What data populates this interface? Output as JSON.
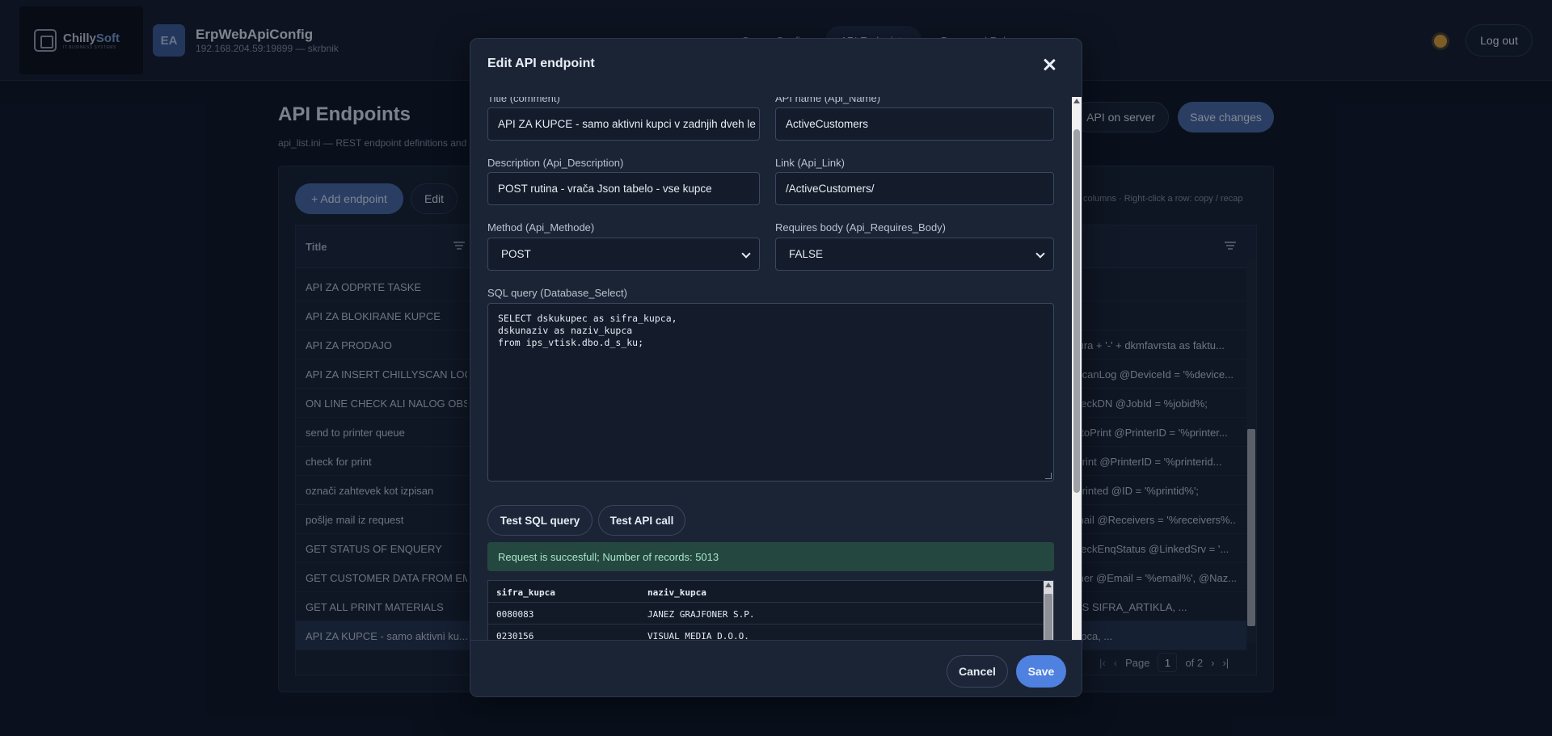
{
  "header": {
    "logo_brand_a": "Chilly",
    "logo_brand_b": "Soft",
    "logo_tag": "IT BUSINESS SYSTEMS",
    "avatar": "EA",
    "app_name": "ErpWebApiConfig",
    "app_sub": "192.168.204.59:19899 — skrbnik",
    "tabs": [
      {
        "label": "Server Config"
      },
      {
        "label": "API Endpoints"
      },
      {
        "label": "Password Rules"
      }
    ],
    "logout_label": "Log out"
  },
  "page": {
    "title": "API Endpoints",
    "subtitle": "api_list.ini — REST endpoint definitions and SQL queries",
    "api_server_label": "API on server",
    "save_changes_label": "Save changes",
    "add_label": "+ Add endpoint",
    "edit_label": "Edit",
    "hint": "columns · Right-click a row: copy / recap"
  },
  "grid": {
    "col_title": "Title",
    "rows": [
      {
        "title": "API ZA ODPRTE TASKE",
        "sql": ""
      },
      {
        "title": "API ZA BLOKIRANE KUPCE",
        "sql": ""
      },
      {
        "title": "API ZA PRODAJO",
        "sql": "tura + '-' + dkmfavrsta as faktu..."
      },
      {
        "title": "API ZA INSERT CHILLYSCAN LOGA",
        "sql": "ScanLog @DeviceId = '%device..."
      },
      {
        "title": "ON LINE CHECK ALI NALOG OBS...",
        "sql": "heckDN @JobId = %jobid%;"
      },
      {
        "title": "send to printer queue",
        "sql": "atoPrint @PrinterID = '%printer..."
      },
      {
        "title": "check for print",
        "sql": "Print @PrinterID = '%printerid..."
      },
      {
        "title": "označi zahtevek kot izpisan",
        "sql": "Printed @ID = '%printid%';"
      },
      {
        "title": "pošlje mail iz request",
        "sql": "mail @Receivers = '%receivers%..."
      },
      {
        "title": "GET STATUS OF ENQUERY",
        "sql": "heckEnqStatus @LinkedSrv = '..."
      },
      {
        "title": "GET CUSTOMER DATA FROM EM...",
        "sql": "mer @Email = '%email%', @Naz..."
      },
      {
        "title": "GET ALL PRINT MATERIALS",
        "sql": "AS SIFRA_ARTIKLA, ..."
      },
      {
        "title": "API ZA KUPCE - samo aktivni ku...",
        "sql": "upca, ..."
      }
    ],
    "pager": {
      "page_label": "Page",
      "page": "1",
      "of_label": "of 2"
    }
  },
  "modal": {
    "title": "Edit API endpoint",
    "title_label": "Title (comment)",
    "title_value": "API ZA KUPCE - samo aktivni kupci v zadnjih dveh le",
    "name_label": "API name (Api_Name)",
    "name_value": "ActiveCustomers",
    "desc_label": "Description (Api_Description)",
    "desc_value": "POST rutina - vrača Json tabelo - vse kupce",
    "link_label": "Link (Api_Link)",
    "link_value": "/ActiveCustomers/",
    "method_label": "Method (Api_Methode)",
    "method_value": "POST",
    "body_label": "Requires body (Api_Requires_Body)",
    "body_value": "FALSE",
    "sql_label": "SQL query (Database_Select)",
    "sql_value": "SELECT dskukupec as sifra_kupca,\ndskunaziv as naziv_kupca\nfrom ips_vtisk.dbo.d_s_ku;",
    "test_sql_label": "Test SQL query",
    "test_api_label": "Test API call",
    "success_text": "Request is succesfull; Number of records: 5013",
    "result": {
      "headers": [
        "sifra_kupca",
        "naziv_kupca"
      ],
      "rows": [
        [
          "0080083",
          "JANEZ GRAJFONER S.P."
        ],
        [
          "0230156",
          "VISUAL MEDIA D.O.O."
        ]
      ]
    },
    "cancel_label": "Cancel",
    "save_label": "Save"
  }
}
